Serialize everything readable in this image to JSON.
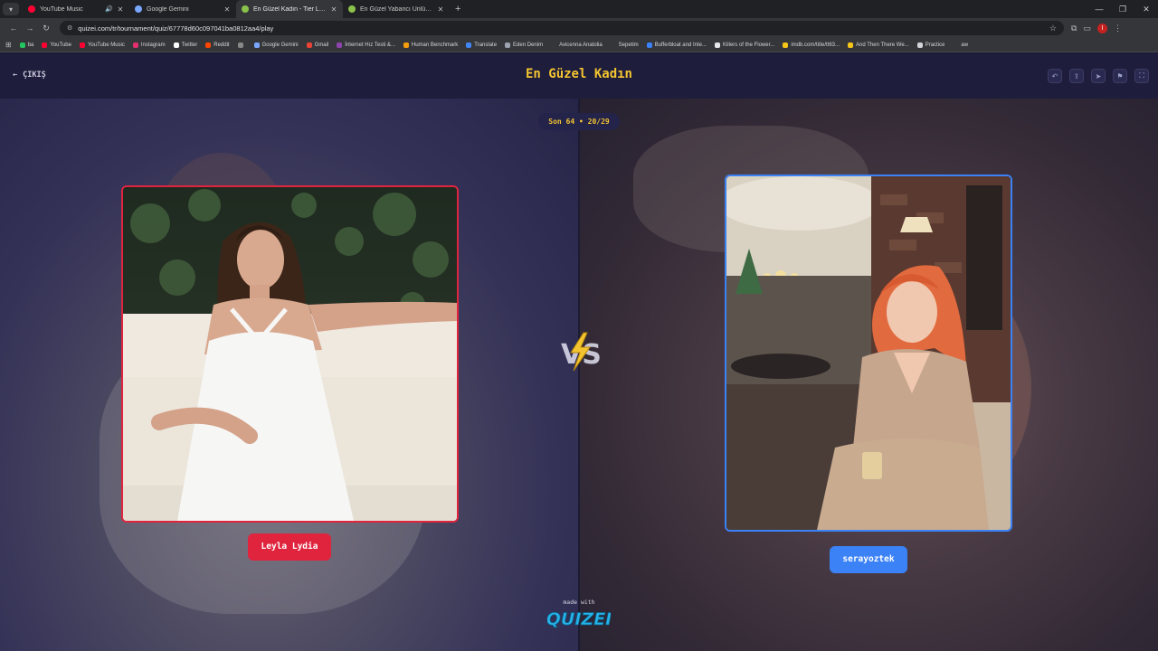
{
  "browser": {
    "tabs": [
      {
        "title": "YouTube Music",
        "color": "#ff0033",
        "active": false,
        "speaker": true
      },
      {
        "title": "Google Gemini",
        "color": "#7aa7ff",
        "active": false,
        "speaker": false
      },
      {
        "title": "En Güzel Kadın - Tier List, Kör S",
        "color": "#8bc34a",
        "active": true,
        "speaker": false
      },
      {
        "title": "En Güzel Yabancı Ünlü Kadın -",
        "color": "#8bc34a",
        "active": false,
        "speaker": false
      }
    ],
    "url": "quizei.com/tr/tournament/quiz/67778d60c097041ba0812aa4/play",
    "bookmarks": [
      {
        "label": "ba",
        "color": "#22c55e"
      },
      {
        "label": "YouTube",
        "color": "#ff0033"
      },
      {
        "label": "YouTube Music",
        "color": "#ff0033"
      },
      {
        "label": "Instagram",
        "color": "#e1306c"
      },
      {
        "label": "Twitter",
        "color": "#ffffff"
      },
      {
        "label": "Reddit",
        "color": "#ff4500"
      },
      {
        "label": "",
        "color": "#888888"
      },
      {
        "label": "Google Gemini",
        "color": "#7aa7ff"
      },
      {
        "label": "Gmail",
        "color": "#ea4335"
      },
      {
        "label": "İnternet Hız Testi &...",
        "color": "#8e44ad"
      },
      {
        "label": "Human Benchmark",
        "color": "#f59e0b"
      },
      {
        "label": "Translate",
        "color": "#4285f4"
      },
      {
        "label": "Eden Denim",
        "color": "#9ca3af"
      },
      {
        "label": "Avicenna Anatolia",
        "color": "#35363a"
      },
      {
        "label": "Sepetim",
        "color": "#35363a"
      },
      {
        "label": "Bufferbloat and Inte...",
        "color": "#3b82f6"
      },
      {
        "label": "Killers of the Flower...",
        "color": "#e5e7eb"
      },
      {
        "label": "imdb.com/title/tt63...",
        "color": "#f5c518"
      },
      {
        "label": "And Then There We...",
        "color": "#f5c518"
      },
      {
        "label": "Practice",
        "color": "#d1d5db"
      },
      {
        "label": "aw",
        "color": "#35363a"
      }
    ]
  },
  "header": {
    "exit_label": "ÇIKIŞ",
    "title": "En Güzel Kadın"
  },
  "round": {
    "label": "Son 64 • 20/29"
  },
  "matchup": {
    "left_name": "Leyla Lydia",
    "right_name": "serayoztek",
    "vs_text": "VS"
  },
  "footer": {
    "made_with": "made with",
    "brand": "QUIZEI"
  },
  "colors": {
    "accent_yellow": "#f4c430",
    "left_red": "#e0243e",
    "right_blue": "#3b82f6"
  }
}
